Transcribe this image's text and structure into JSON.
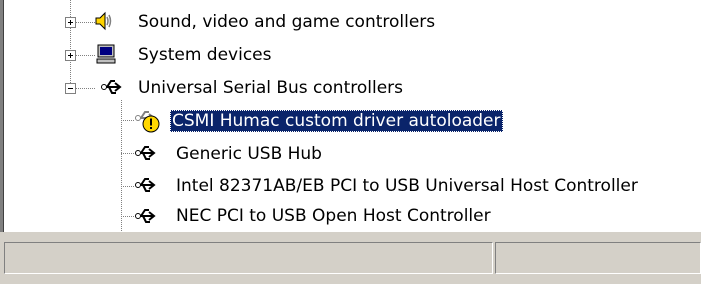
{
  "tree": {
    "top_partial": "",
    "items": [
      {
        "label": "Sound, video and game controllers",
        "expander": "+"
      },
      {
        "label": "System devices",
        "expander": "+"
      },
      {
        "label": "Universal Serial Bus controllers",
        "expander": "−"
      }
    ],
    "usb_children": [
      {
        "label": "CSMI Humac custom driver autoloader",
        "selected": true,
        "warning": true
      },
      {
        "label": "Generic USB Hub"
      },
      {
        "label": "Intel 82371AB/EB PCI to USB Universal Host Controller"
      },
      {
        "label": "NEC PCI to USB Open Host Controller"
      }
    ]
  },
  "statusbar": {
    "pane1": "",
    "pane2": ""
  },
  "colors": {
    "selection": "#0a246a",
    "warning": "#ffd700",
    "window": "#d4d0c8"
  },
  "icons": [
    "sound-icon",
    "computer-icon",
    "usb-icon",
    "warning-icon"
  ]
}
